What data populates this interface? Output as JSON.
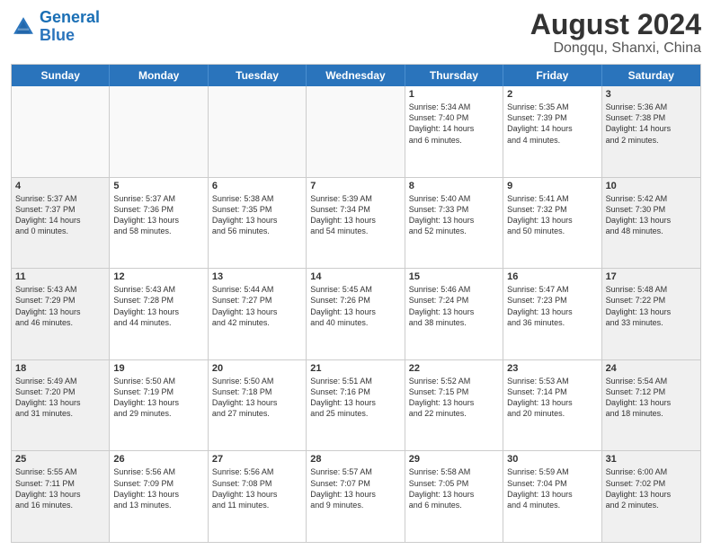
{
  "header": {
    "logo_general": "General",
    "logo_blue": "Blue",
    "month": "August 2024",
    "location": "Dongqu, Shanxi, China"
  },
  "days_of_week": [
    "Sunday",
    "Monday",
    "Tuesday",
    "Wednesday",
    "Thursday",
    "Friday",
    "Saturday"
  ],
  "rows": [
    [
      {
        "day": "",
        "lines": [],
        "empty": true
      },
      {
        "day": "",
        "lines": [],
        "empty": true
      },
      {
        "day": "",
        "lines": [],
        "empty": true
      },
      {
        "day": "",
        "lines": [],
        "empty": true
      },
      {
        "day": "1",
        "lines": [
          "Sunrise: 5:34 AM",
          "Sunset: 7:40 PM",
          "Daylight: 14 hours",
          "and 6 minutes."
        ]
      },
      {
        "day": "2",
        "lines": [
          "Sunrise: 5:35 AM",
          "Sunset: 7:39 PM",
          "Daylight: 14 hours",
          "and 4 minutes."
        ]
      },
      {
        "day": "3",
        "lines": [
          "Sunrise: 5:36 AM",
          "Sunset: 7:38 PM",
          "Daylight: 14 hours",
          "and 2 minutes."
        ],
        "shaded": true
      }
    ],
    [
      {
        "day": "4",
        "lines": [
          "Sunrise: 5:37 AM",
          "Sunset: 7:37 PM",
          "Daylight: 14 hours",
          "and 0 minutes."
        ],
        "shaded": true
      },
      {
        "day": "5",
        "lines": [
          "Sunrise: 5:37 AM",
          "Sunset: 7:36 PM",
          "Daylight: 13 hours",
          "and 58 minutes."
        ]
      },
      {
        "day": "6",
        "lines": [
          "Sunrise: 5:38 AM",
          "Sunset: 7:35 PM",
          "Daylight: 13 hours",
          "and 56 minutes."
        ]
      },
      {
        "day": "7",
        "lines": [
          "Sunrise: 5:39 AM",
          "Sunset: 7:34 PM",
          "Daylight: 13 hours",
          "and 54 minutes."
        ]
      },
      {
        "day": "8",
        "lines": [
          "Sunrise: 5:40 AM",
          "Sunset: 7:33 PM",
          "Daylight: 13 hours",
          "and 52 minutes."
        ]
      },
      {
        "day": "9",
        "lines": [
          "Sunrise: 5:41 AM",
          "Sunset: 7:32 PM",
          "Daylight: 13 hours",
          "and 50 minutes."
        ]
      },
      {
        "day": "10",
        "lines": [
          "Sunrise: 5:42 AM",
          "Sunset: 7:30 PM",
          "Daylight: 13 hours",
          "and 48 minutes."
        ],
        "shaded": true
      }
    ],
    [
      {
        "day": "11",
        "lines": [
          "Sunrise: 5:43 AM",
          "Sunset: 7:29 PM",
          "Daylight: 13 hours",
          "and 46 minutes."
        ],
        "shaded": true
      },
      {
        "day": "12",
        "lines": [
          "Sunrise: 5:43 AM",
          "Sunset: 7:28 PM",
          "Daylight: 13 hours",
          "and 44 minutes."
        ]
      },
      {
        "day": "13",
        "lines": [
          "Sunrise: 5:44 AM",
          "Sunset: 7:27 PM",
          "Daylight: 13 hours",
          "and 42 minutes."
        ]
      },
      {
        "day": "14",
        "lines": [
          "Sunrise: 5:45 AM",
          "Sunset: 7:26 PM",
          "Daylight: 13 hours",
          "and 40 minutes."
        ]
      },
      {
        "day": "15",
        "lines": [
          "Sunrise: 5:46 AM",
          "Sunset: 7:24 PM",
          "Daylight: 13 hours",
          "and 38 minutes."
        ]
      },
      {
        "day": "16",
        "lines": [
          "Sunrise: 5:47 AM",
          "Sunset: 7:23 PM",
          "Daylight: 13 hours",
          "and 36 minutes."
        ]
      },
      {
        "day": "17",
        "lines": [
          "Sunrise: 5:48 AM",
          "Sunset: 7:22 PM",
          "Daylight: 13 hours",
          "and 33 minutes."
        ],
        "shaded": true
      }
    ],
    [
      {
        "day": "18",
        "lines": [
          "Sunrise: 5:49 AM",
          "Sunset: 7:20 PM",
          "Daylight: 13 hours",
          "and 31 minutes."
        ],
        "shaded": true
      },
      {
        "day": "19",
        "lines": [
          "Sunrise: 5:50 AM",
          "Sunset: 7:19 PM",
          "Daylight: 13 hours",
          "and 29 minutes."
        ]
      },
      {
        "day": "20",
        "lines": [
          "Sunrise: 5:50 AM",
          "Sunset: 7:18 PM",
          "Daylight: 13 hours",
          "and 27 minutes."
        ]
      },
      {
        "day": "21",
        "lines": [
          "Sunrise: 5:51 AM",
          "Sunset: 7:16 PM",
          "Daylight: 13 hours",
          "and 25 minutes."
        ]
      },
      {
        "day": "22",
        "lines": [
          "Sunrise: 5:52 AM",
          "Sunset: 7:15 PM",
          "Daylight: 13 hours",
          "and 22 minutes."
        ]
      },
      {
        "day": "23",
        "lines": [
          "Sunrise: 5:53 AM",
          "Sunset: 7:14 PM",
          "Daylight: 13 hours",
          "and 20 minutes."
        ]
      },
      {
        "day": "24",
        "lines": [
          "Sunrise: 5:54 AM",
          "Sunset: 7:12 PM",
          "Daylight: 13 hours",
          "and 18 minutes."
        ],
        "shaded": true
      }
    ],
    [
      {
        "day": "25",
        "lines": [
          "Sunrise: 5:55 AM",
          "Sunset: 7:11 PM",
          "Daylight: 13 hours",
          "and 16 minutes."
        ],
        "shaded": true
      },
      {
        "day": "26",
        "lines": [
          "Sunrise: 5:56 AM",
          "Sunset: 7:09 PM",
          "Daylight: 13 hours",
          "and 13 minutes."
        ]
      },
      {
        "day": "27",
        "lines": [
          "Sunrise: 5:56 AM",
          "Sunset: 7:08 PM",
          "Daylight: 13 hours",
          "and 11 minutes."
        ]
      },
      {
        "day": "28",
        "lines": [
          "Sunrise: 5:57 AM",
          "Sunset: 7:07 PM",
          "Daylight: 13 hours",
          "and 9 minutes."
        ]
      },
      {
        "day": "29",
        "lines": [
          "Sunrise: 5:58 AM",
          "Sunset: 7:05 PM",
          "Daylight: 13 hours",
          "and 6 minutes."
        ]
      },
      {
        "day": "30",
        "lines": [
          "Sunrise: 5:59 AM",
          "Sunset: 7:04 PM",
          "Daylight: 13 hours",
          "and 4 minutes."
        ]
      },
      {
        "day": "31",
        "lines": [
          "Sunrise: 6:00 AM",
          "Sunset: 7:02 PM",
          "Daylight: 13 hours",
          "and 2 minutes."
        ],
        "shaded": true
      }
    ]
  ]
}
